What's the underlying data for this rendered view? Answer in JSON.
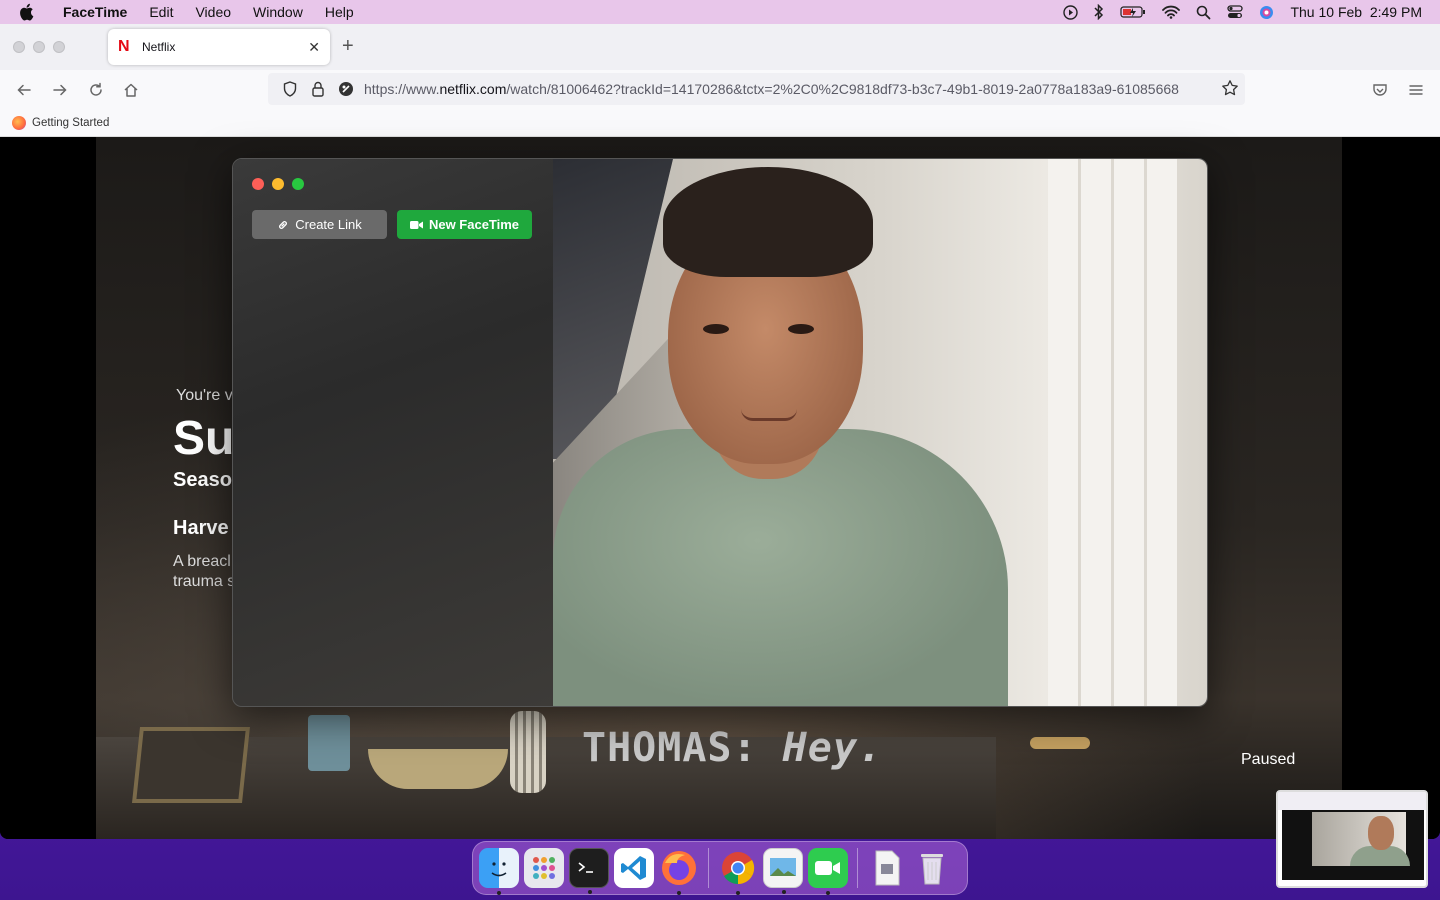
{
  "menubar": {
    "app": "FaceTime",
    "items": [
      "Edit",
      "Video",
      "Window",
      "Help"
    ],
    "datetime": "Thu 10 Feb  2:49 PM"
  },
  "browser": {
    "tab": {
      "title": "Netflix"
    },
    "url": {
      "prefix": "https://www.",
      "domain": "netflix.com",
      "path": "/watch/81006462?trackId=14170286&tctx=2%2C0%2C9818df73-b3c7-49b1-8019-2a0778a183a9-61085668"
    },
    "bookmarks": [
      "Getting Started"
    ]
  },
  "netflix": {
    "watching": "You're v",
    "title": "Su",
    "season": "Seaso",
    "episode": "Harve",
    "desc_line1": "A breacl",
    "desc_line2": "trauma s",
    "subtitle_speaker": "THOMAS:",
    "subtitle_text": "Hey.",
    "status": "Paused"
  },
  "facetime": {
    "create_link_label": "Create Link",
    "new_facetime_label": "New FaceTime"
  },
  "colors": {
    "menubar_bg": "#e8c6ea",
    "facetime_green": "#1fa83d",
    "netflix_red": "#e50914"
  },
  "dock": {
    "apps": [
      "finder-icon",
      "launchpad-icon",
      "terminal-icon",
      "vscode-icon",
      "firefox-icon",
      "chrome-icon",
      "preview-icon",
      "facetime-icon",
      "document-icon",
      "trash-icon"
    ]
  }
}
